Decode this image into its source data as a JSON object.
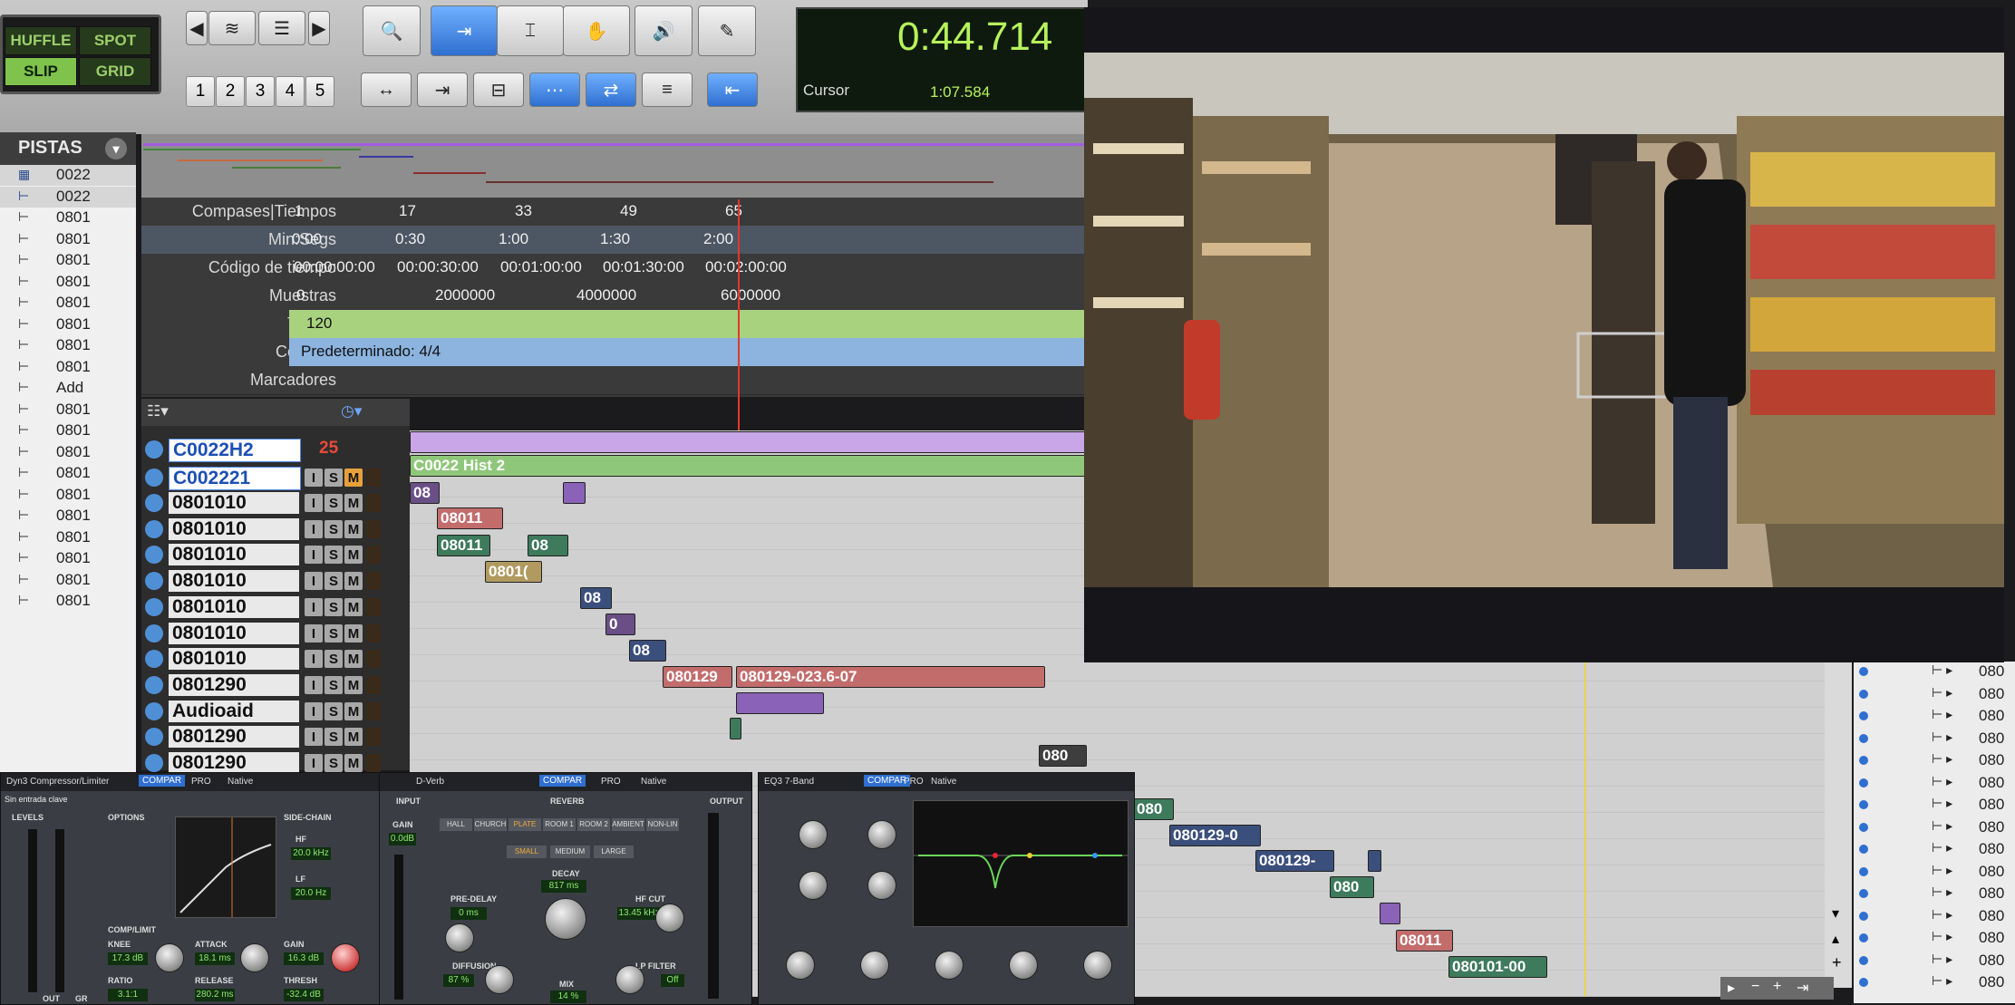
{
  "modes": {
    "shuffle": "HUFFLE",
    "spot": "SPOT",
    "slip": "SLIP",
    "grid": "GRID"
  },
  "zoom_presets": [
    "1",
    "2",
    "3",
    "4",
    "5"
  ],
  "counter": {
    "main": "0:44.714",
    "cursor_label": "Cursor",
    "cursor_value": "1:07.584"
  },
  "pistas": {
    "title": "PISTAS",
    "items": [
      "0022",
      "0022",
      "0801",
      "0801",
      "0801",
      "0801",
      "0801",
      "0801",
      "0801",
      "0801",
      "Add",
      "0801",
      "0801",
      "0801",
      "0801",
      "0801",
      "0801",
      "0801",
      "0801",
      "0801",
      "0801"
    ]
  },
  "rulers": {
    "rows": [
      {
        "label": "Compases|Tiempos",
        "ticks": [
          "1",
          "17",
          "33",
          "49",
          "65"
        ]
      },
      {
        "label": "Min:Segs",
        "ticks": [
          "0:00",
          "0:30",
          "1:00",
          "1:30",
          "2:00"
        ]
      },
      {
        "label": "Código de tiempo",
        "ticks": [
          "00:00:00:00",
          "00:00:30:00",
          "00:01:00:00",
          "00:01:30:00",
          "00:02:00:00"
        ]
      },
      {
        "label": "Muestras",
        "ticks": [
          "0",
          "2000000",
          "4000000",
          "6000000"
        ]
      },
      {
        "label": "Tempo",
        "ticks": [
          "120"
        ]
      },
      {
        "label": "Compás",
        "ticks": [
          "Predeterminado: 4/4"
        ]
      },
      {
        "label": "Marcadores",
        "ticks": []
      }
    ]
  },
  "tracks": [
    {
      "name": "C0022H2",
      "extra": "25"
    },
    {
      "name": "C002221",
      "extra": ""
    },
    {
      "name": "0801010",
      "extra": ""
    },
    {
      "name": "0801010",
      "extra": ""
    },
    {
      "name": "0801010",
      "extra": ""
    },
    {
      "name": "0801010",
      "extra": ""
    },
    {
      "name": "0801010",
      "extra": ""
    },
    {
      "name": "0801010",
      "extra": ""
    },
    {
      "name": "0801010",
      "extra": ""
    },
    {
      "name": "0801290",
      "extra": ""
    },
    {
      "name": "Audioaid",
      "extra": ""
    },
    {
      "name": "0801290",
      "extra": ""
    },
    {
      "name": "0801290",
      "extra": ""
    }
  ],
  "track_buttons": {
    "i": "I",
    "s": "S",
    "m": "M"
  },
  "clips": [
    {
      "text": "",
      "color": "#c9a6e8"
    },
    {
      "text": "C0022 Hist 2",
      "color": "#8fc77a"
    },
    {
      "text": "08",
      "color": "#6a4f86"
    },
    {
      "text": "",
      "color": "#8a62b8"
    },
    {
      "text": "08011",
      "color": "#c26c6c"
    },
    {
      "text": "08011",
      "color": "#3e7a5c"
    },
    {
      "text": "08",
      "color": "#3e7a5c"
    },
    {
      "text": "0801(",
      "color": "#b09a60"
    },
    {
      "text": "08",
      "color": "#3b4f7c"
    },
    {
      "text": "0",
      "color": "#6a4f86"
    },
    {
      "text": "08",
      "color": "#3b4f7c"
    },
    {
      "text": "080129",
      "color": "#c26c6c"
    },
    {
      "text": "080129-023.6-07",
      "color": "#c26c6c"
    },
    {
      "text": "",
      "color": "#8a62b8"
    },
    {
      "text": "",
      "color": "#3e7a5c"
    },
    {
      "text": "080",
      "color": "#3e3e3e"
    },
    {
      "text": "080",
      "color": "#3e7a5c"
    },
    {
      "text": "080129-0",
      "color": "#3b4f7c"
    },
    {
      "text": "080129-",
      "color": "#3b4f7c"
    },
    {
      "text": "",
      "color": "#3b4f7c"
    },
    {
      "text": "080",
      "color": "#3e7a5c"
    },
    {
      "text": "",
      "color": "#8a62b8"
    },
    {
      "text": "08011",
      "color": "#c26c6c"
    },
    {
      "text": "080101-00",
      "color": "#3e7a5c"
    }
  ],
  "right_strip": [
    "080",
    "080",
    "080",
    "080",
    "080",
    "080",
    "080",
    "080",
    "080",
    "080",
    "080",
    "080",
    "080",
    "080",
    "080"
  ],
  "plugins": {
    "dyn3": {
      "title": "Dyn3 Compressor/Limiter",
      "compare": "COMPAR",
      "pro": "PRO",
      "native": "Native",
      "key": "Sin entrada clave",
      "levels": "LEVELS",
      "options": "OPTIONS",
      "sidechain": "SIDE-CHAIN",
      "comp": "COMP/LIMIT",
      "hf": "HF",
      "hf_val": "20.0 kHz",
      "lf": "LF",
      "lf_val": "20.0 Hz",
      "knee": "KNEE",
      "knee_val": "17.3 dB",
      "attack": "ATTACK",
      "attack_val": "18.1 ms",
      "gain": "GAIN",
      "gain_val": "16.3 dB",
      "ratio": "RATIO",
      "ratio_val": "3.1:1",
      "release": "RELEASE",
      "release_val": "280.2 ms",
      "thresh": "THRESH",
      "thresh_val": "-32.4 dB",
      "out": "OUT",
      "gr": "GR"
    },
    "dverb": {
      "title": "D-Verb",
      "compare": "COMPAR",
      "pro": "PRO",
      "native": "Native",
      "input": "INPUT",
      "reverb": "REVERB",
      "output": "OUTPUT",
      "gain": "GAIN",
      "gain_val": "0.0dB",
      "algos": [
        "HALL",
        "CHURCH",
        "PLATE",
        "ROOM 1",
        "ROOM 2",
        "AMBIENT",
        "NON-LIN"
      ],
      "sizes": [
        "SMALL",
        "MEDIUM",
        "LARGE"
      ],
      "decay": "DECAY",
      "decay_val": "817 ms",
      "predelay": "PRE-DELAY",
      "predelay_val": "0 ms",
      "hfcut": "HF CUT",
      "hfcut_val": "13.45 kHz",
      "diffusion": "DIFFUSION",
      "diffusion_val": "87 %",
      "lpfilter": "LP FILTER",
      "lpfilter_val": "Off",
      "mix": "MIX",
      "mix_val": "14 %"
    },
    "eq": {
      "title": "EQ3 7-Band",
      "compare": "COMPAR",
      "pro": "PRO",
      "native": "Native"
    }
  }
}
